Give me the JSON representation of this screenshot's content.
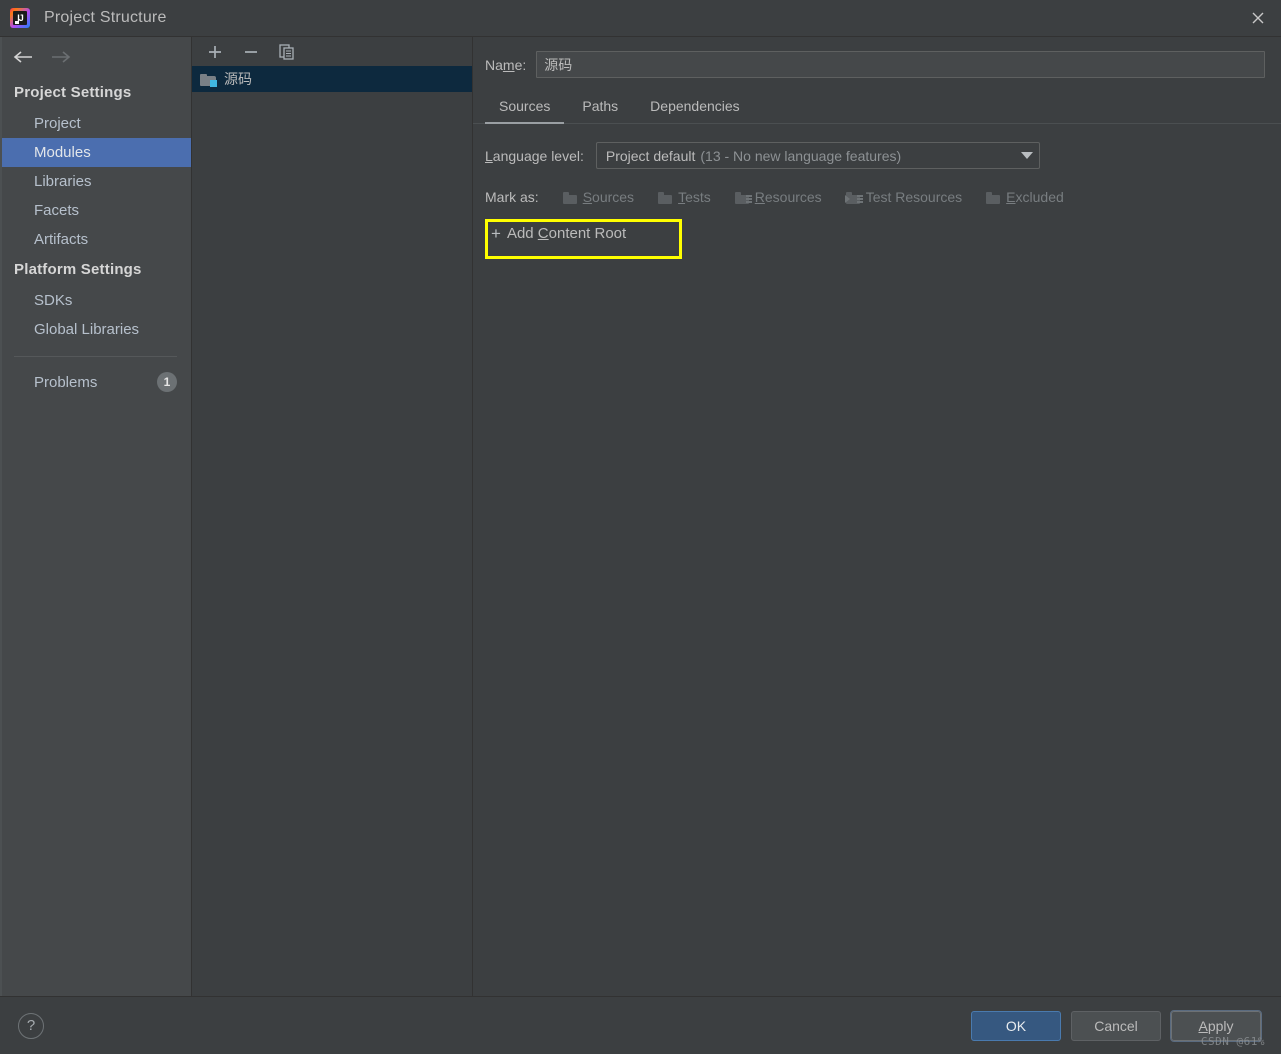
{
  "window": {
    "title": "Project Structure",
    "logo_text": "IJ",
    "close_icon": "close-icon"
  },
  "sidebar": {
    "back_icon": "arrow-left-icon",
    "forward_icon": "arrow-right-icon",
    "sections": [
      {
        "header": "Project Settings",
        "items": [
          {
            "label": "Project",
            "selected": false
          },
          {
            "label": "Modules",
            "selected": true
          },
          {
            "label": "Libraries",
            "selected": false
          },
          {
            "label": "Facets",
            "selected": false
          },
          {
            "label": "Artifacts",
            "selected": false
          }
        ]
      },
      {
        "header": "Platform Settings",
        "items": [
          {
            "label": "SDKs",
            "selected": false
          },
          {
            "label": "Global Libraries",
            "selected": false
          }
        ]
      }
    ],
    "problems": {
      "label": "Problems",
      "count": "1"
    }
  },
  "modules": {
    "toolbar": {
      "add_icon": "plus-icon",
      "remove_icon": "minus-icon",
      "copy_icon": "copy-icon"
    },
    "items": [
      {
        "name": "源码",
        "selected": true,
        "icon": "module-folder-icon"
      }
    ]
  },
  "detail": {
    "name_label_pre": "Na",
    "name_label_mnemonic": "m",
    "name_label_post": "e:",
    "name_value": "源码",
    "name_placeholder": "",
    "tabs": [
      {
        "label": "Sources",
        "active": true
      },
      {
        "label": "Paths",
        "active": false
      },
      {
        "label": "Dependencies",
        "active": false
      }
    ],
    "language_level": {
      "label_mnemonic": "L",
      "label_rest": "anguage level:",
      "value": "Project default",
      "detail": "(13 - No new language features)",
      "arrow_icon": "chevron-down-icon"
    },
    "mark_as": {
      "label": "Mark as:",
      "options": [
        {
          "pre": "",
          "mnemonic": "S",
          "post": "ources",
          "icon": "folder-sources-icon"
        },
        {
          "pre": "",
          "mnemonic": "T",
          "post": "ests",
          "icon": "folder-tests-icon"
        },
        {
          "pre": "",
          "mnemonic": "R",
          "post": "esources",
          "icon": "folder-resources-icon"
        },
        {
          "pre": "Test Resources",
          "mnemonic": "",
          "post": "",
          "icon": "folder-test-resources-icon"
        },
        {
          "pre": "",
          "mnemonic": "E",
          "post": "xcluded",
          "icon": "folder-excluded-icon"
        }
      ]
    },
    "add_content_root": {
      "plus": "+",
      "pre": "Add ",
      "mnemonic": "C",
      "post": "ontent Root",
      "icon": "plus-icon"
    }
  },
  "footer": {
    "help_label": "?",
    "buttons": [
      {
        "label": "OK",
        "style": "primary",
        "mnemonic": ""
      },
      {
        "label": "Cancel",
        "style": "secondary",
        "mnemonic": ""
      },
      {
        "label": "Apply",
        "style": "focused",
        "mnemonic": "A"
      }
    ],
    "apply_pre": "",
    "apply_mnemonic": "A",
    "apply_post": "pply"
  },
  "watermark": "CSDN @61%"
}
